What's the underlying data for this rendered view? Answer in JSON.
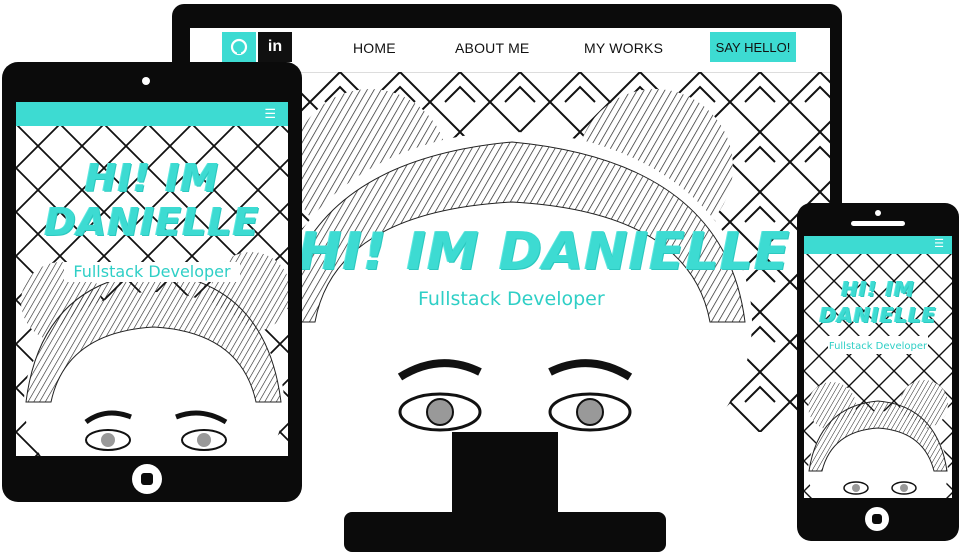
{
  "desktop": {
    "nav": {
      "github_icon": "github-icon",
      "linkedin_label": "in",
      "home": "HOME",
      "about": "ABOUT ME",
      "works": "MY WORKS",
      "cta": "SAY HELLO!"
    },
    "hero": {
      "title": "HI! IM DANIELLE",
      "subtitle": "Fullstack Developer"
    }
  },
  "tablet": {
    "menu_icon": "hamburger-icon",
    "title_line1": "HI! IM",
    "title_line2": "DANIELLE",
    "subtitle": "Fullstack Developer"
  },
  "phone": {
    "menu_icon": "hamburger-icon",
    "title_line1": "HI! IM",
    "title_line2": "DANIELLE",
    "subtitle": "Fullstack Developer"
  },
  "colors": {
    "accent": "#3ddbd2",
    "frame": "#0b0b0b"
  }
}
